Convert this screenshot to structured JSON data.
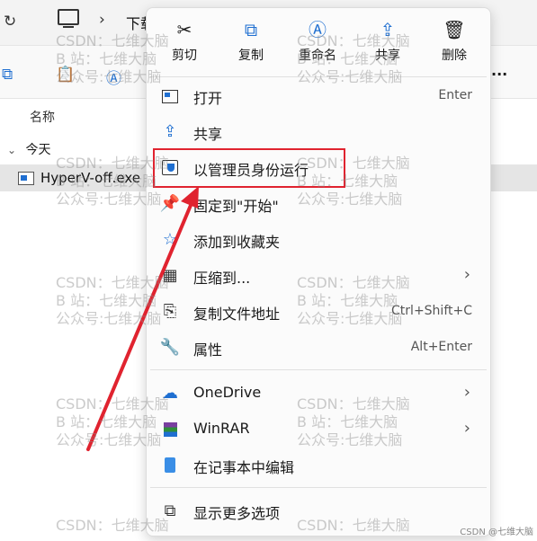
{
  "explorer": {
    "address_segment": "下载",
    "column_name": "名称",
    "group_today": "今天",
    "file_name": "HyperV-off.exe",
    "more_dots": "..."
  },
  "menu": {
    "quick_actions": [
      {
        "label": "剪切",
        "icon": "scissors-icon"
      },
      {
        "label": "复制",
        "icon": "copy-icon"
      },
      {
        "label": "重命名",
        "icon": "rename-icon"
      },
      {
        "label": "共享",
        "icon": "share-icon"
      },
      {
        "label": "删除",
        "icon": "trash-icon"
      }
    ],
    "items": {
      "open": {
        "label": "打开",
        "shortcut": "Enter"
      },
      "share": {
        "label": "共享"
      },
      "run_as_admin": {
        "label": "以管理员身份运行"
      },
      "pin_start": {
        "label": "固定到\"开始\""
      },
      "add_favorites": {
        "label": "添加到收藏夹"
      },
      "compress": {
        "label": "压缩到..."
      },
      "copy_path": {
        "label": "复制文件地址",
        "shortcut": "Ctrl+Shift+C"
      },
      "properties": {
        "label": "属性",
        "shortcut": "Alt+Enter"
      },
      "onedrive": {
        "label": "OneDrive"
      },
      "winrar": {
        "label": "WinRAR"
      },
      "notepad": {
        "label": "在记事本中编辑"
      },
      "more_options": {
        "label": "显示更多选项"
      }
    }
  },
  "watermark": {
    "line1": "CSDN：七维大脑",
    "line2": "B 站：七维大脑",
    "line3": "公众号:七维大脑",
    "corner": "CSDN @七维大脑"
  },
  "colors": {
    "accent": "#1f6fd1",
    "highlight_box": "#e0232f",
    "arrow": "#e0232f"
  }
}
